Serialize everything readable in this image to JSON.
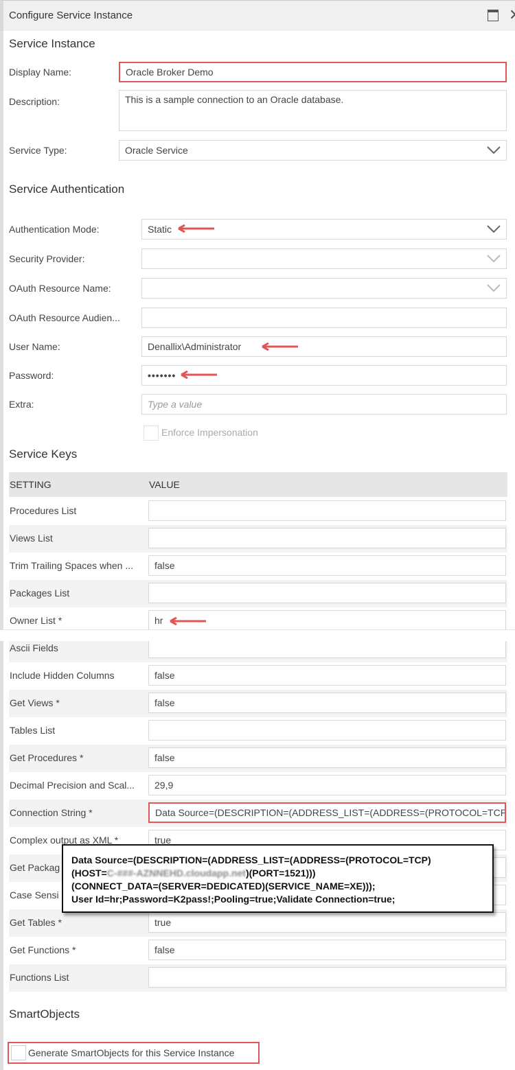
{
  "window": {
    "title": "Configure Service Instance",
    "maximize_icon": "maximize-icon",
    "close_icon": "close-icon"
  },
  "service_instance": {
    "heading": "Service Instance",
    "display_name_label": "Display Name:",
    "display_name_value": "Oracle Broker Demo",
    "description_label": "Description:",
    "description_value": "This is a sample connection to an Oracle database.",
    "service_type_label": "Service Type:",
    "service_type_value": "Oracle Service"
  },
  "authentication": {
    "heading": "Service Authentication",
    "auth_mode_label": "Authentication Mode:",
    "auth_mode_value": "Static",
    "security_provider_label": "Security Provider:",
    "oauth_resource_name_label": "OAuth Resource Name:",
    "oauth_resource_audience_label": "OAuth Resource Audien...",
    "user_name_label": "User Name:",
    "user_name_value": "Denallix\\Administrator",
    "password_label": "Password:",
    "password_value": "•••••••",
    "extra_label": "Extra:",
    "extra_placeholder": "Type a value",
    "enforce_impersonation_label": "Enforce Impersonation",
    "enforce_impersonation_checked": false
  },
  "service_keys": {
    "heading": "Service Keys",
    "col_setting": "SETTING",
    "col_value": "VALUE",
    "rows": [
      {
        "setting": "Procedures List",
        "value": ""
      },
      {
        "setting": "Views List",
        "value": ""
      },
      {
        "setting": "Trim Trailing Spaces when ...",
        "value": "false"
      },
      {
        "setting": "Packages List",
        "value": ""
      },
      {
        "setting": "Owner List *",
        "value": "hr"
      },
      {
        "setting": "Ascii Fields",
        "value": ""
      },
      {
        "setting": "Include Hidden Columns",
        "value": "false"
      },
      {
        "setting": "Get Views *",
        "value": "false"
      },
      {
        "setting": "Tables List",
        "value": ""
      },
      {
        "setting": "Get Procedures *",
        "value": "false"
      },
      {
        "setting": "Decimal Precision and Scal...",
        "value": "29,9"
      },
      {
        "setting": "Connection String *",
        "value": "Data Source=(DESCRIPTION=(ADDRESS_LIST=(ADDRESS=(PROTOCOL=TCP"
      },
      {
        "setting": "Complex output as XML *",
        "value": "true"
      },
      {
        "setting": "Get Packag",
        "value": ""
      },
      {
        "setting": "Case Sensi",
        "value": ""
      },
      {
        "setting": "Get Tables *",
        "value": "true"
      },
      {
        "setting": "Get Functions *",
        "value": "false"
      },
      {
        "setting": "Functions List",
        "value": ""
      }
    ]
  },
  "callout": {
    "line1": "Data Source=(DESCRIPTION=(ADDRESS_LIST=(ADDRESS=(PROTOCOL=TCP)",
    "line2_prefix": "(HOST=",
    "line2_blurred": "C-###-AZNNEHD.cloudapp.net",
    "line2_suffix": ")(PORT=1521)))",
    "line3": "(CONNECT_DATA=(SERVER=DEDICATED)(SERVICE_NAME=XE)));",
    "line4": "User Id=hr;Password=K2pass!;Pooling=true;Validate Connection=true;"
  },
  "smartobjects": {
    "heading": "SmartObjects",
    "generate_label": "Generate SmartObjects for this Service Instance",
    "generate_checked": false
  },
  "colors": {
    "highlight": "#e05555",
    "grid_header": "#e6e6e6",
    "row_alt": "#f3f3f3"
  }
}
